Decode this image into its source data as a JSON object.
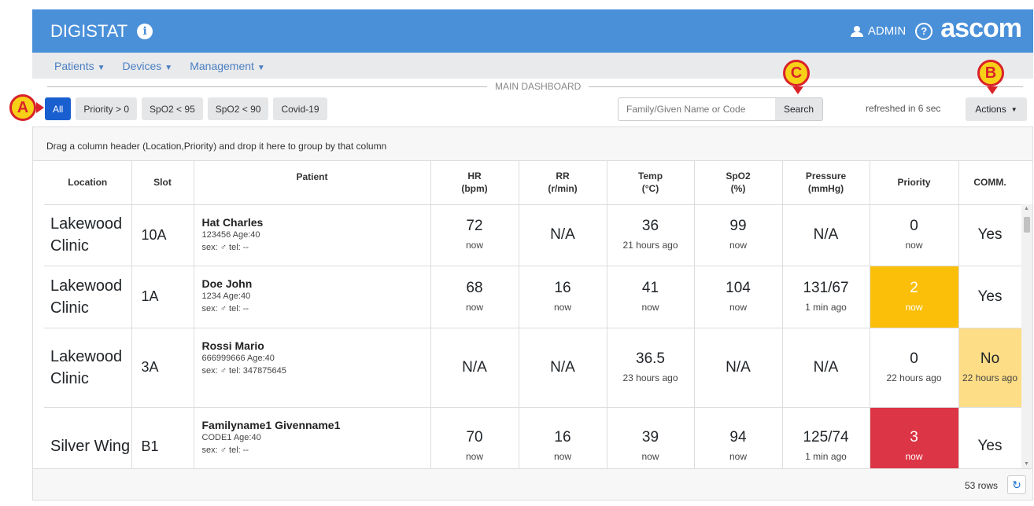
{
  "header": {
    "brand": "DIGISTAT",
    "user": "ADMIN",
    "logo": "ascom",
    "icons": [
      "info-icon",
      "user-icon",
      "help-icon"
    ]
  },
  "nav": [
    {
      "label": "Patients"
    },
    {
      "label": "Devices"
    },
    {
      "label": "Management"
    }
  ],
  "dashboard_title": "MAIN DASHBOARD",
  "filters": [
    "All",
    "Priority > 0",
    "SpO2 < 95",
    "SpO2 < 90",
    "Covid-19"
  ],
  "search": {
    "placeholder": "Family/Given Name or Code",
    "button": "Search"
  },
  "refresh_text": "refreshed in 6 sec",
  "actions_label": "Actions",
  "group_hint": "Drag a column header (Location,Priority) and drop it here to group by that column",
  "columns": [
    {
      "line1": "Location",
      "line2": ""
    },
    {
      "line1": "Slot",
      "line2": ""
    },
    {
      "line1": "Patient",
      "line2": ""
    },
    {
      "line1": "HR",
      "line2": "(bpm)"
    },
    {
      "line1": "RR",
      "line2": "(r/min)"
    },
    {
      "line1": "Temp",
      "line2": "(°C)"
    },
    {
      "line1": "SpO2",
      "line2": "(%)"
    },
    {
      "line1": "Pressure",
      "line2": "(mmHg)"
    },
    {
      "line1": "Priority",
      "line2": ""
    },
    {
      "line1": "COMM.",
      "line2": ""
    }
  ],
  "rows": [
    {
      "location": "Lakewood Clinic",
      "slot": "10A",
      "name": "Hat Charles",
      "info": "123456 Age:40",
      "sex_tel": "sex: ♂   tel: --",
      "hr": {
        "v": "72",
        "t": "now"
      },
      "rr": {
        "v": "N/A",
        "t": ""
      },
      "temp": {
        "v": "36",
        "t": "21 hours ago"
      },
      "spo2": {
        "v": "99",
        "t": "now"
      },
      "pressure": {
        "v": "N/A",
        "t": ""
      },
      "priority": {
        "v": "0",
        "t": "now"
      },
      "comm": {
        "v": "Yes",
        "t": ""
      }
    },
    {
      "location": "Lakewood Clinic",
      "slot": "1A",
      "name": "Doe John",
      "info": "1234 Age:40",
      "sex_tel": "sex: ♂   tel: --",
      "hr": {
        "v": "68",
        "t": "now"
      },
      "rr": {
        "v": "16",
        "t": "now"
      },
      "temp": {
        "v": "41",
        "t": "now"
      },
      "spo2": {
        "v": "104",
        "t": "now"
      },
      "pressure": {
        "v": "131/67",
        "t": "1 min ago"
      },
      "priority": {
        "v": "2",
        "t": "now"
      },
      "comm": {
        "v": "Yes",
        "t": ""
      }
    },
    {
      "location": "Lakewood Clinic",
      "slot": "3A",
      "name": "Rossi Mario",
      "info": "666999666 Age:40",
      "sex_tel": "sex: ♂   tel: 347875645",
      "hr": {
        "v": "N/A",
        "t": ""
      },
      "rr": {
        "v": "N/A",
        "t": ""
      },
      "temp": {
        "v": "36.5",
        "t": "23 hours ago"
      },
      "spo2": {
        "v": "N/A",
        "t": ""
      },
      "pressure": {
        "v": "N/A",
        "t": ""
      },
      "priority": {
        "v": "0",
        "t": "22 hours ago"
      },
      "comm": {
        "v": "No",
        "t": "22 hours ago"
      }
    },
    {
      "location": "Silver Wing",
      "slot": "B1",
      "name": "Familyname1 Givenname1",
      "info": "CODE1 Age:40",
      "sex_tel": "sex: ♂   tel: --",
      "hr": {
        "v": "70",
        "t": "now"
      },
      "rr": {
        "v": "16",
        "t": "now"
      },
      "temp": {
        "v": "39",
        "t": "now"
      },
      "spo2": {
        "v": "94",
        "t": "now"
      },
      "pressure": {
        "v": "125/74",
        "t": "1 min ago"
      },
      "priority": {
        "v": "3",
        "t": "now"
      },
      "comm": {
        "v": "Yes",
        "t": ""
      }
    }
  ],
  "footer": {
    "rows_count": "53 rows"
  },
  "markers": {
    "a": "A",
    "b": "B",
    "c": "C"
  },
  "colors": {
    "header": "#4a90d9",
    "active_filter": "#1a5fd0",
    "priority_2": "#fbbf0a",
    "priority_3": "#dc3545",
    "comm_no": "#fddd86"
  }
}
